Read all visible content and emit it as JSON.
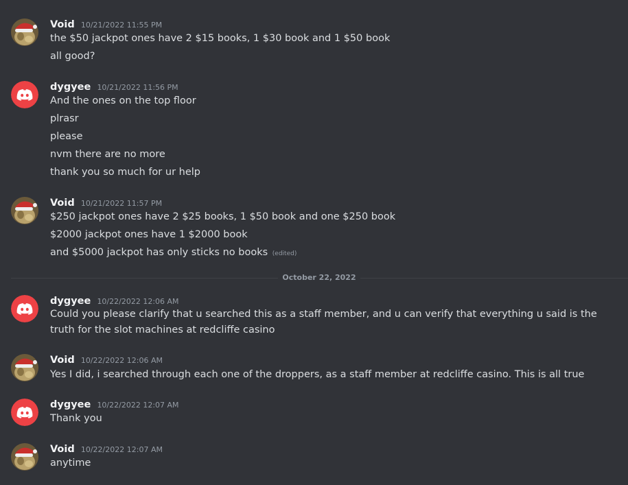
{
  "colors": {
    "background": "#313338",
    "discord_red": "#ed4245",
    "username": "#f2f3f5",
    "timestamp": "#949ba4",
    "text": "#dbdee1"
  },
  "date_divider": "October 22, 2022",
  "groups": [
    {
      "username": "Void",
      "timestamp": "10/21/2022 11:55 PM",
      "avatar_icon": "santa-hat-avatar-icon",
      "messages": [
        "the $50 jackpot ones have 2 $15 books, 1 $30 book and 1 $50 book",
        "all good?"
      ]
    },
    {
      "username": "dygyee",
      "timestamp": "10/21/2022 11:56 PM",
      "avatar_icon": "discord-logo-icon",
      "messages": [
        "And the ones on the top floor",
        "plrasr",
        "please",
        "nvm there are no more",
        "thank you so much for ur help"
      ]
    },
    {
      "username": "Void",
      "timestamp": "10/21/2022 11:57 PM",
      "avatar_icon": "santa-hat-avatar-icon",
      "messages": [
        "$250 jackpot ones have 2 $25 books, 1 $50 book and one $250 book",
        "$2000 jackpot ones have 1 $2000 book",
        "and $5000 jackpot has only sticks no books"
      ],
      "edited_label": "(edited)"
    },
    {
      "username": "dygyee",
      "timestamp": "10/22/2022 12:06 AM",
      "avatar_icon": "discord-logo-icon",
      "messages": [
        "Could you please clarify that u searched this as a staff member, and u can verify that everything u said is the truth for the slot machines at redcliffe casino"
      ]
    },
    {
      "username": "Void",
      "timestamp": "10/22/2022 12:06 AM",
      "avatar_icon": "santa-hat-avatar-icon",
      "messages": [
        "Yes I did, i searched through each one of the droppers, as a staff member at redcliffe casino. This is all true"
      ]
    },
    {
      "username": "dygyee",
      "timestamp": "10/22/2022 12:07 AM",
      "avatar_icon": "discord-logo-icon",
      "messages": [
        "Thank you"
      ]
    },
    {
      "username": "Void",
      "timestamp": "10/22/2022 12:07 AM",
      "avatar_icon": "santa-hat-avatar-icon",
      "messages": [
        "anytime"
      ]
    }
  ]
}
